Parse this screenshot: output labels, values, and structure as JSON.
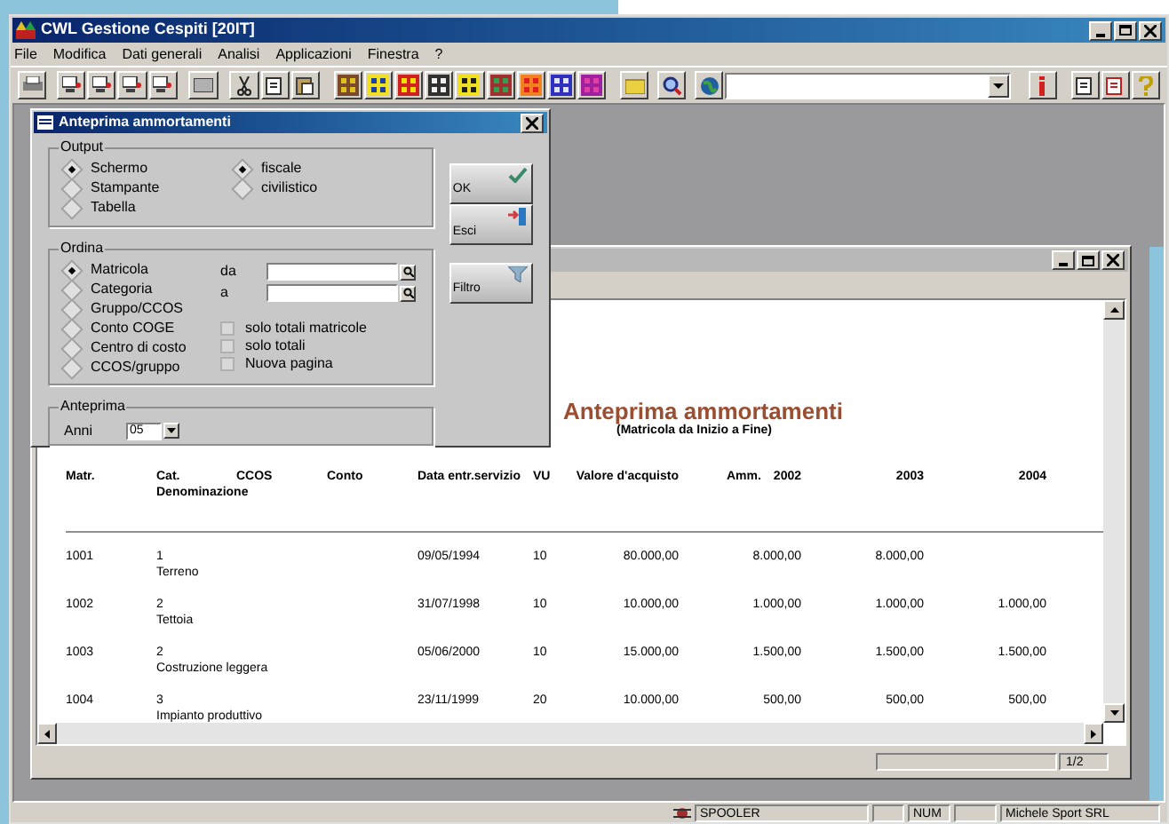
{
  "window": {
    "title": "CWL Gestione Cespiti [20IT]"
  },
  "menu": [
    "File",
    "Modifica",
    "Dati generali",
    "Analisi",
    "Applicazioni",
    "Finestra",
    "?"
  ],
  "dialog": {
    "title": "Anteprima ammortamenti",
    "output": {
      "label": "Output",
      "options": [
        {
          "label": "Schermo",
          "selected": true
        },
        {
          "label": "Stampante",
          "selected": false
        },
        {
          "label": "Tabella",
          "selected": false
        }
      ],
      "mode": [
        {
          "label": "fiscale",
          "selected": true
        },
        {
          "label": "civilistico",
          "selected": false
        }
      ]
    },
    "buttons": [
      {
        "label": "OK",
        "kind": "ok"
      },
      {
        "label": "Esci",
        "kind": "exit"
      },
      {
        "label": "Filtro",
        "kind": "filter"
      }
    ],
    "ordina": {
      "label": "Ordina",
      "options": [
        {
          "label": "Matricola",
          "selected": true
        },
        {
          "label": "Categoria",
          "selected": false
        },
        {
          "label": "Gruppo/CCOS",
          "selected": false
        },
        {
          "label": "Conto COGE",
          "selected": false
        },
        {
          "label": "Centro di costo",
          "selected": false
        },
        {
          "label": "CCOS/gruppo",
          "selected": false
        }
      ],
      "fields": [
        {
          "label": "da"
        },
        {
          "label": "a"
        }
      ],
      "checks": [
        {
          "label": "solo totali matricole",
          "checked": false
        },
        {
          "label": "solo totali",
          "checked": false
        },
        {
          "label": "Nuova pagina",
          "checked": false
        }
      ]
    },
    "anteprima": {
      "label": "Anteprima",
      "field_label": "Anni",
      "value": "05"
    }
  },
  "report": {
    "title": "Anteprima ammortamenti",
    "subtitle": "(Matricola da Inizio a Fine)",
    "columns": [
      "Matr.",
      "Cat.",
      "CCOS",
      "Conto",
      "Data entr.servizio",
      "VU",
      "Valore d'acquisto",
      "Amm.",
      "2002",
      "2003",
      "2004"
    ],
    "subheader": "Denominazione",
    "rows": [
      {
        "matr": "1001",
        "cat": "1",
        "name": "Terreno",
        "date": "09/05/1994",
        "vu": "10",
        "value": "80.000,00",
        "y2002": "8.000,00",
        "y2003": "8.000,00"
      },
      {
        "matr": "1002",
        "cat": "2",
        "name": "Tettoia",
        "date": "31/07/1998",
        "vu": "10",
        "value": "10.000,00",
        "y2002": "1.000,00",
        "y2003": "1.000,00",
        "y2004": "1.000,00"
      },
      {
        "matr": "1003",
        "cat": "2",
        "name": "Costruzione leggera",
        "date": "05/06/2000",
        "vu": "10",
        "value": "15.000,00",
        "y2002": "1.500,00",
        "y2003": "1.500,00",
        "y2004": "1.500,00"
      },
      {
        "matr": "1004",
        "cat": "3",
        "name": "Impianto produttivo",
        "date": "23/11/1999",
        "vu": "20",
        "value": "10.000,00",
        "y2002": "500,00",
        "y2003": "500,00",
        "y2004": "500,00"
      }
    ],
    "page": "1/2"
  },
  "status_bar": [
    "SPOOLER",
    "NUM",
    "Michele Sport SRL"
  ]
}
